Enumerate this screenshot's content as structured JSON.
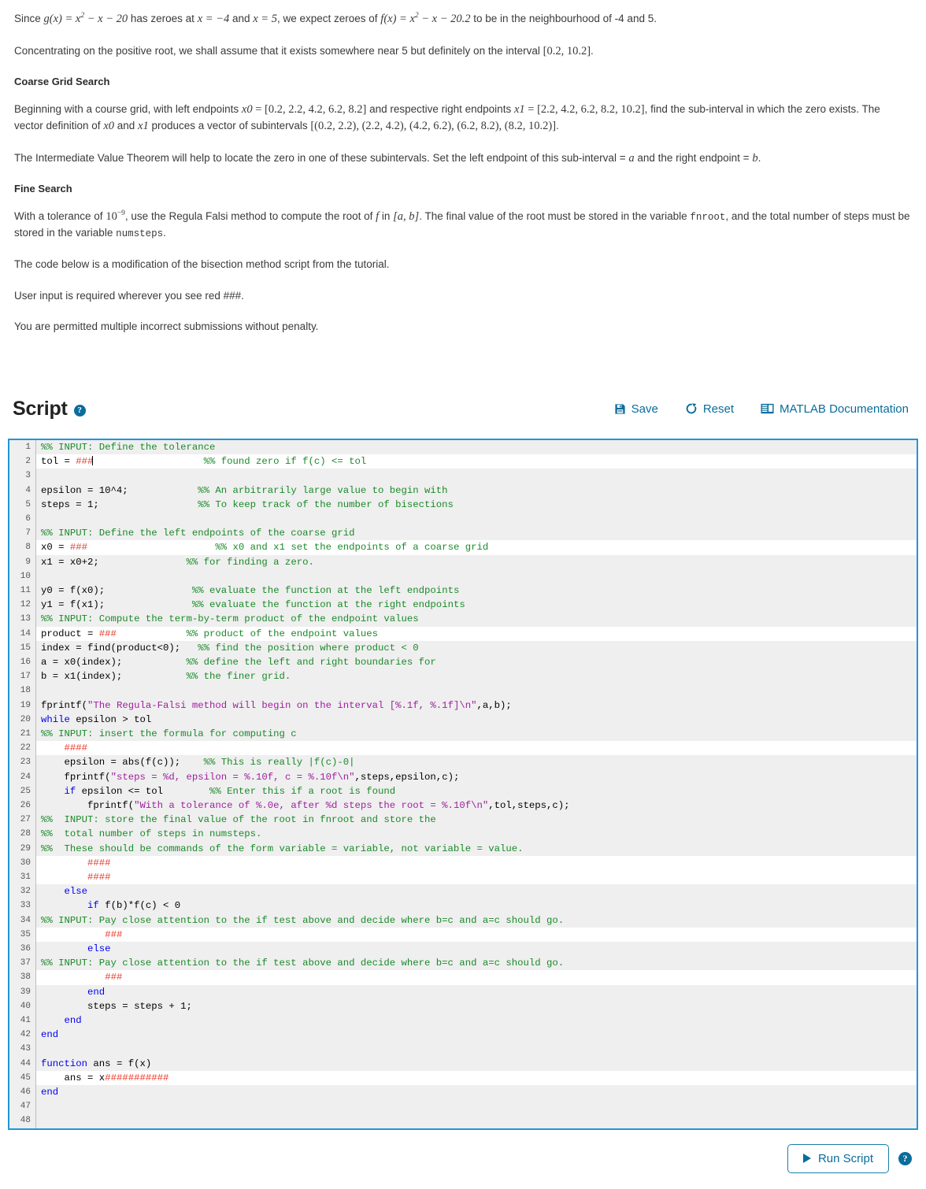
{
  "intro": {
    "para1_pre": "Since ",
    "para1_g": "g(x) = x",
    "para1_g_sup": "2",
    "para1_g_rest": " − x − 20",
    "para1_mid": " has zeroes at ",
    "para1_x1": "x = −4",
    "para1_and": " and ",
    "para1_x2": "x = 5",
    "para1_mid2": ", we expect zeroes of ",
    "para1_f": "f(x) = x",
    "para1_f_sup": "2",
    "para1_f_rest": " − x − 20.2",
    "para1_end": " to be in the neighbourhood of -4 and 5.",
    "para2_pre": "Concentrating on the positive root, we shall assume that it exists somewhere near 5 but definitely on the interval ",
    "para2_interval": "[0.2, 10.2]",
    "para2_end": ".",
    "heading_coarse": "Coarse Grid Search",
    "para3_pre": "Beginning with a course grid, with left endpoints ",
    "para3_x0": "x0",
    "para3_eq1": " = [0.2, 2.2, 4.2, 6.2, 8.2]",
    "para3_mid": " and respective right endpoints ",
    "para3_x1": "x1",
    "para3_eq2": " = [2.2, 4.2, 6.2, 8.2, 10.2]",
    "para3_mid2": ", find the sub-interval in which the zero exists. The vector definition of ",
    "para3_x0b": "x0",
    "para3_and": " and ",
    "para3_x1b": "x1",
    "para3_mid3": " produces a vector of subintervals ",
    "para3_vec": "[(0.2, 2.2), (2.2, 4.2), (4.2, 6.2), (6.2, 8.2), (8.2, 10.2)]",
    "para3_end": ".",
    "para4_pre": "The Intermediate Value Theorem will help to locate the zero in one of these subintervals. Set the left endpoint of this sub-interval = ",
    "para4_a": "a",
    "para4_mid": " and the right endpoint = ",
    "para4_b": "b",
    "para4_end": ".",
    "heading_fine": "Fine Search",
    "para5_pre": "With a tolerance of ",
    "para5_tol": "10",
    "para5_tol_sup": "−9",
    "para5_mid": ", use the Regula Falsi method to compute the root of ",
    "para5_f": "f",
    "para5_in": " in ",
    "para5_ab": "[a, b]",
    "para5_mid2": ". The final value of the root must be stored in the variable ",
    "para5_var1": "fnroot",
    "para5_mid3": ", and the total number of steps must be stored in the variable ",
    "para5_var2": "numsteps",
    "para5_end": ".",
    "para6": "The code below is a modification of the bisection method script from the tutorial.",
    "para7": "User input is required wherever you see red ###.",
    "para8": "You are permitted multiple incorrect submissions without penalty."
  },
  "script_section": {
    "title": "Script",
    "help_glyph": "?",
    "tools": [
      {
        "label": "Save",
        "icon": "save-icon"
      },
      {
        "label": "Reset",
        "icon": "reset-icon"
      },
      {
        "label": "MATLAB Documentation",
        "icon": "documentation-icon"
      }
    ]
  },
  "editor": {
    "border_color": "#2196d8",
    "readonly_row_color": "#efefef",
    "editable_row_color": "#ffffff",
    "comment_color": "#1a8a28",
    "keyword_color": "#0000ee",
    "string_color": "#a020a0",
    "input_marker_color": "#e8392b",
    "lines": [
      {
        "n": 1,
        "editable": false,
        "tokens": [
          {
            "t": "%% INPUT: Define the tolerance",
            "c": "com"
          }
        ]
      },
      {
        "n": 2,
        "editable": true,
        "tokens": [
          {
            "t": "tol = ",
            "c": ""
          },
          {
            "t": "###",
            "c": "red"
          },
          {
            "t": "CARET",
            "c": "caret"
          },
          {
            "t": "                   %% found zero if f(c) <= tol",
            "c": "com"
          }
        ]
      },
      {
        "n": 3,
        "editable": false,
        "tokens": []
      },
      {
        "n": 4,
        "editable": false,
        "tokens": [
          {
            "t": "epsilon = 10^4;",
            "c": ""
          },
          {
            "t": "            %% An arbitrarily large value to begin with",
            "c": "com"
          }
        ]
      },
      {
        "n": 5,
        "editable": false,
        "tokens": [
          {
            "t": "steps = 1;",
            "c": ""
          },
          {
            "t": "                 %% To keep track of the number of bisections",
            "c": "com"
          }
        ]
      },
      {
        "n": 6,
        "editable": false,
        "tokens": []
      },
      {
        "n": 7,
        "editable": false,
        "tokens": [
          {
            "t": "%% INPUT: Define the left endpoints of the coarse grid",
            "c": "com"
          }
        ]
      },
      {
        "n": 8,
        "editable": true,
        "tokens": [
          {
            "t": "x0 = ",
            "c": ""
          },
          {
            "t": "###",
            "c": "red"
          },
          {
            "t": "                      %% x0 and x1 set the endpoints of a coarse grid",
            "c": "com"
          }
        ]
      },
      {
        "n": 9,
        "editable": false,
        "tokens": [
          {
            "t": "x1 = x0+2;",
            "c": ""
          },
          {
            "t": "               %% for finding a zero.",
            "c": "com"
          }
        ]
      },
      {
        "n": 10,
        "editable": false,
        "tokens": []
      },
      {
        "n": 11,
        "editable": false,
        "tokens": [
          {
            "t": "y0 = f(x0);",
            "c": ""
          },
          {
            "t": "               %% evaluate the function at the left endpoints",
            "c": "com"
          }
        ]
      },
      {
        "n": 12,
        "editable": false,
        "tokens": [
          {
            "t": "y1 = f(x1);",
            "c": ""
          },
          {
            "t": "               %% evaluate the function at the right endpoints",
            "c": "com"
          }
        ]
      },
      {
        "n": 13,
        "editable": false,
        "tokens": [
          {
            "t": "%% INPUT: Compute the term-by-term product of the endpoint values",
            "c": "com"
          }
        ]
      },
      {
        "n": 14,
        "editable": true,
        "tokens": [
          {
            "t": "product = ",
            "c": ""
          },
          {
            "t": "###",
            "c": "red"
          },
          {
            "t": "            %% product of the endpoint values",
            "c": "com"
          }
        ]
      },
      {
        "n": 15,
        "editable": false,
        "tokens": [
          {
            "t": "index = find(product<0);",
            "c": ""
          },
          {
            "t": "   %% find the position where product < 0",
            "c": "com"
          }
        ]
      },
      {
        "n": 16,
        "editable": false,
        "tokens": [
          {
            "t": "a = x0(index);",
            "c": ""
          },
          {
            "t": "           %% define the left and right boundaries for",
            "c": "com"
          }
        ]
      },
      {
        "n": 17,
        "editable": false,
        "tokens": [
          {
            "t": "b = x1(index);",
            "c": ""
          },
          {
            "t": "           %% the finer grid.",
            "c": "com"
          }
        ]
      },
      {
        "n": 18,
        "editable": false,
        "tokens": []
      },
      {
        "n": 19,
        "editable": false,
        "tokens": [
          {
            "t": "fprintf(",
            "c": ""
          },
          {
            "t": "\"The Regula-Falsi method will begin on the interval [%.1f, %.1f]\\n\"",
            "c": "str"
          },
          {
            "t": ",a,b);",
            "c": ""
          }
        ]
      },
      {
        "n": 20,
        "editable": false,
        "tokens": [
          {
            "t": "while",
            "c": "kw"
          },
          {
            "t": " epsilon > tol",
            "c": ""
          }
        ]
      },
      {
        "n": 21,
        "editable": false,
        "tokens": [
          {
            "t": "%% INPUT: insert the formula for computing c",
            "c": "com"
          }
        ]
      },
      {
        "n": 22,
        "editable": true,
        "tokens": [
          {
            "t": "    ",
            "c": ""
          },
          {
            "t": "####",
            "c": "red"
          }
        ]
      },
      {
        "n": 23,
        "editable": false,
        "tokens": [
          {
            "t": "    epsilon = abs(f(c));",
            "c": ""
          },
          {
            "t": "    %% This is really |f(c)-0|",
            "c": "com"
          }
        ]
      },
      {
        "n": 24,
        "editable": false,
        "tokens": [
          {
            "t": "    fprintf(",
            "c": ""
          },
          {
            "t": "\"steps = %d, epsilon = %.10f, c = %.10f\\n\"",
            "c": "str"
          },
          {
            "t": ",steps,epsilon,c);",
            "c": ""
          }
        ]
      },
      {
        "n": 25,
        "editable": false,
        "tokens": [
          {
            "t": "    ",
            "c": ""
          },
          {
            "t": "if",
            "c": "kw"
          },
          {
            "t": " epsilon <= tol",
            "c": ""
          },
          {
            "t": "        %% Enter this if a root is found",
            "c": "com"
          }
        ]
      },
      {
        "n": 26,
        "editable": false,
        "tokens": [
          {
            "t": "        fprintf(",
            "c": ""
          },
          {
            "t": "\"With a tolerance of %.0e, after %d steps the root = %.10f\\n\"",
            "c": "str"
          },
          {
            "t": ",tol,steps,c);",
            "c": ""
          }
        ]
      },
      {
        "n": 27,
        "editable": false,
        "tokens": [
          {
            "t": "%%  INPUT: store the final value of the root in fnroot and store the",
            "c": "com"
          }
        ]
      },
      {
        "n": 28,
        "editable": false,
        "tokens": [
          {
            "t": "%%  total number of steps in numsteps.",
            "c": "com"
          }
        ]
      },
      {
        "n": 29,
        "editable": false,
        "tokens": [
          {
            "t": "%%  These should be commands of the form variable = variable, not variable = value.",
            "c": "com"
          }
        ]
      },
      {
        "n": 30,
        "editable": true,
        "tokens": [
          {
            "t": "        ",
            "c": ""
          },
          {
            "t": "####",
            "c": "red"
          }
        ]
      },
      {
        "n": 31,
        "editable": true,
        "tokens": [
          {
            "t": "        ",
            "c": ""
          },
          {
            "t": "####",
            "c": "red"
          }
        ]
      },
      {
        "n": 32,
        "editable": false,
        "tokens": [
          {
            "t": "    ",
            "c": ""
          },
          {
            "t": "else",
            "c": "kw"
          }
        ]
      },
      {
        "n": 33,
        "editable": false,
        "tokens": [
          {
            "t": "        ",
            "c": ""
          },
          {
            "t": "if",
            "c": "kw"
          },
          {
            "t": " f(b)*f(c) < 0",
            "c": ""
          }
        ]
      },
      {
        "n": 34,
        "editable": false,
        "tokens": [
          {
            "t": "%% INPUT: Pay close attention to the if test above and decide where b=c and a=c should go.",
            "c": "com"
          }
        ]
      },
      {
        "n": 35,
        "editable": true,
        "tokens": [
          {
            "t": "           ",
            "c": ""
          },
          {
            "t": "###",
            "c": "red"
          }
        ]
      },
      {
        "n": 36,
        "editable": false,
        "tokens": [
          {
            "t": "        ",
            "c": ""
          },
          {
            "t": "else",
            "c": "kw"
          }
        ]
      },
      {
        "n": 37,
        "editable": false,
        "tokens": [
          {
            "t": "%% INPUT: Pay close attention to the if test above and decide where b=c and a=c should go.",
            "c": "com"
          }
        ]
      },
      {
        "n": 38,
        "editable": true,
        "tokens": [
          {
            "t": "           ",
            "c": ""
          },
          {
            "t": "###",
            "c": "red"
          }
        ]
      },
      {
        "n": 39,
        "editable": false,
        "tokens": [
          {
            "t": "        ",
            "c": ""
          },
          {
            "t": "end",
            "c": "kw"
          }
        ]
      },
      {
        "n": 40,
        "editable": false,
        "tokens": [
          {
            "t": "        steps = steps + 1;",
            "c": ""
          }
        ]
      },
      {
        "n": 41,
        "editable": false,
        "tokens": [
          {
            "t": "    ",
            "c": ""
          },
          {
            "t": "end",
            "c": "kw"
          }
        ]
      },
      {
        "n": 42,
        "editable": false,
        "tokens": [
          {
            "t": "end",
            "c": "kw"
          }
        ]
      },
      {
        "n": 43,
        "editable": false,
        "tokens": []
      },
      {
        "n": 44,
        "editable": false,
        "tokens": [
          {
            "t": "function",
            "c": "kw"
          },
          {
            "t": " ans = f(x)",
            "c": ""
          }
        ]
      },
      {
        "n": 45,
        "editable": true,
        "tokens": [
          {
            "t": "    ans = x",
            "c": ""
          },
          {
            "t": "###########",
            "c": "red"
          }
        ]
      },
      {
        "n": 46,
        "editable": false,
        "tokens": [
          {
            "t": "end",
            "c": "kw"
          }
        ]
      },
      {
        "n": 47,
        "editable": false,
        "tokens": []
      },
      {
        "n": 48,
        "editable": false,
        "tokens": []
      }
    ]
  },
  "footer": {
    "run_label": "Run Script",
    "help_glyph": "?"
  }
}
